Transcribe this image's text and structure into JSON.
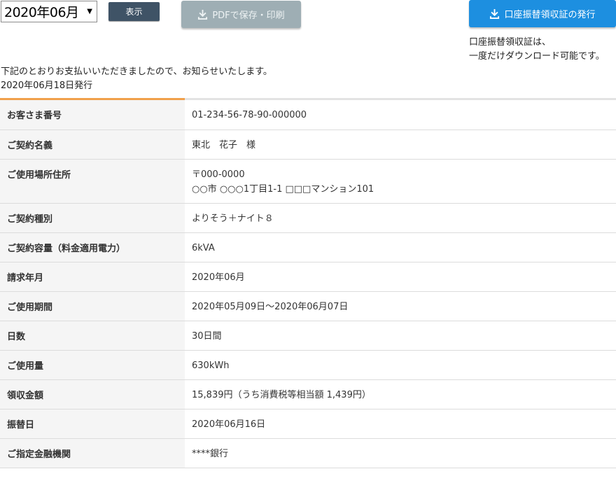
{
  "toolbar": {
    "month_value": "2020年06月",
    "show_label": "表示",
    "pdf_label": "PDFで保存・印刷",
    "receipt_label": "口座振替領収証の発行",
    "receipt_note_line1": "口座振替領収証は、",
    "receipt_note_line2": "一度だけダウンロード可能です。"
  },
  "intro": {
    "message": "下記のとおりお支払いいただきましたので、お知らせいたします。",
    "issue_date": "2020年06月18日発行"
  },
  "details": [
    {
      "label": "お客さま番号",
      "value": "01-234-56-78-90-000000"
    },
    {
      "label": "ご契約名義",
      "value": "東北　花子　様"
    },
    {
      "label": "ご使用場所住所",
      "value": "〒000-0000",
      "value2": "○○市 ○○○1丁目1-1 □□□マンション101"
    },
    {
      "label": "ご契約種別",
      "value": "よりそう＋ナイト８"
    },
    {
      "label": "ご契約容量（料金適用電力）",
      "value": "6kVA"
    },
    {
      "label": "請求年月",
      "value": "2020年06月"
    },
    {
      "label": "ご使用期間",
      "value": "2020年05月09日～2020年06月07日"
    },
    {
      "label": "日数",
      "value": "30日間"
    },
    {
      "label": "ご使用量",
      "value": "630kWh"
    },
    {
      "label": "領収金額",
      "value": "15,839円（うち消費税等相当額 1,439円）"
    },
    {
      "label": "振替日",
      "value": "2020年06月16日"
    },
    {
      "label": "ご指定金融機関",
      "value": "****銀行"
    }
  ],
  "colors": {
    "primary_button": "#1d8fe0",
    "show_button": "#3f5366",
    "pdf_button_disabled": "#9eaeb4",
    "accent_orange": "#f0a04b"
  }
}
